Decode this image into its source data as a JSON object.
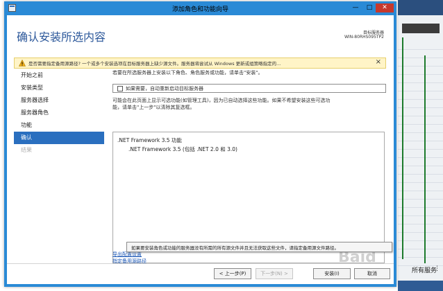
{
  "window": {
    "title": "添加角色和功能向导"
  },
  "header": {
    "title": "确认安装所选内容",
    "server_label": "目标服务器",
    "server_name": "WIN-80RHS095TP2"
  },
  "warning": {
    "text": "是否需要指定备用源路径? 一个或多个安装选项在目标服务器上缺少源文件。服务器将尝试从 Windows 更新或组策略指定的...",
    "close": "×"
  },
  "nav": {
    "items": [
      {
        "label": "开始之前"
      },
      {
        "label": "安装类型"
      },
      {
        "label": "服务器选择"
      },
      {
        "label": "服务器角色"
      },
      {
        "label": "功能"
      },
      {
        "label": "确认"
      },
      {
        "label": "结果"
      }
    ]
  },
  "content": {
    "intro": "若要在所选服务器上安装以下角色、角色服务或功能，请单击\"安装\"。",
    "restart_checkbox_label": "如果需要，自动重新启动目标服务器",
    "note_line1": "可能会在此页面上显示可选功能(如管理工具)，因为已自动选择这些功能。如果不希望安装这些可选功",
    "note_line2": "能，请单击\"上一步\"以清除其复选框。",
    "features": [
      ".NET Framework 3.5 功能",
      ".NET Framework 3.5 (包括 .NET 2.0 和 3.0)"
    ],
    "link_export": "导出配置设置",
    "link_alternate_source": "指定备用源路径"
  },
  "tooltip": {
    "text": "如果要安装角色或功能的服务器没有所需的所有源文件并且无法获取这些文件，请指定备用源文件路径。"
  },
  "buttons": {
    "prev": "< 上一步(P)",
    "next": "下一步(N) >",
    "install": "安装(I)",
    "cancel": "取消"
  },
  "background_app": {
    "corner_text": "所有服务",
    "dots": "⋮"
  },
  "watermark": {
    "text": "Baid"
  },
  "colors": {
    "accent": "#2a8ad6",
    "header_title": "#2b579a",
    "nav_active": "#2a6fbf",
    "warning_bg": "#fff4c7",
    "link": "#1a56b5",
    "close_button": "#c7382c"
  }
}
